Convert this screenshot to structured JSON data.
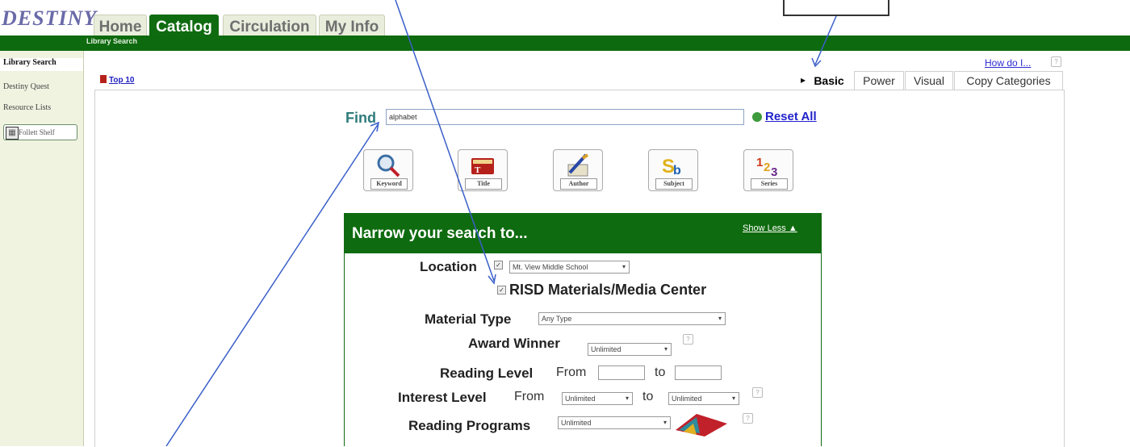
{
  "logo": {
    "text": "DESTINY"
  },
  "tabs": [
    {
      "label": "Home"
    },
    {
      "label": "Catalog"
    },
    {
      "label": "Circulation"
    },
    {
      "label": "My Info"
    }
  ],
  "subbar": {
    "label": "Library Search"
  },
  "sidebar": {
    "items": [
      {
        "label": "Library Search"
      },
      {
        "label": "Destiny Quest"
      },
      {
        "label": "Resource Lists"
      }
    ],
    "shelf_label": "Follett Shelf"
  },
  "top10": {
    "label": "Top 10"
  },
  "how_do": {
    "label": "How do I...",
    "help": "?"
  },
  "search_tabs": [
    {
      "label": "Basic"
    },
    {
      "label": "Power"
    },
    {
      "label": "Visual"
    },
    {
      "label": "Copy Categories"
    }
  ],
  "find": {
    "label": "Find",
    "value": "alphabet",
    "reset_label": "Reset All"
  },
  "search_buttons": [
    {
      "label": "Keyword",
      "icon": "magnifier-icon"
    },
    {
      "label": "Title",
      "icon": "book-title-icon"
    },
    {
      "label": "Author",
      "icon": "pen-author-icon"
    },
    {
      "label": "Subject",
      "icon": "subject-letters-icon"
    },
    {
      "label": "Series",
      "icon": "series-numbers-icon"
    }
  ],
  "narrow": {
    "title": "Narrow your search to...",
    "show_less": "Show Less",
    "location_label": "Location",
    "location_value": "Mt. View Middle School",
    "risd_label": "RISD Materials/Media Center",
    "material_label": "Material Type",
    "material_value": "Any Type",
    "award_label": "Award Winner",
    "award_value": "Unlimited",
    "reading_label": "Reading Level",
    "from_label": "From",
    "to_label": "to",
    "interest_label": "Interest Level",
    "interest_from_value": "Unlimited",
    "interest_to_value": "Unlimited",
    "programs_label": "Reading Programs",
    "programs_value": "Unlimited",
    "help": "?"
  },
  "colors": {
    "brand_green": "#0f6b0f",
    "link_blue": "#2222cc",
    "annotation_blue": "#3a5fc8"
  }
}
